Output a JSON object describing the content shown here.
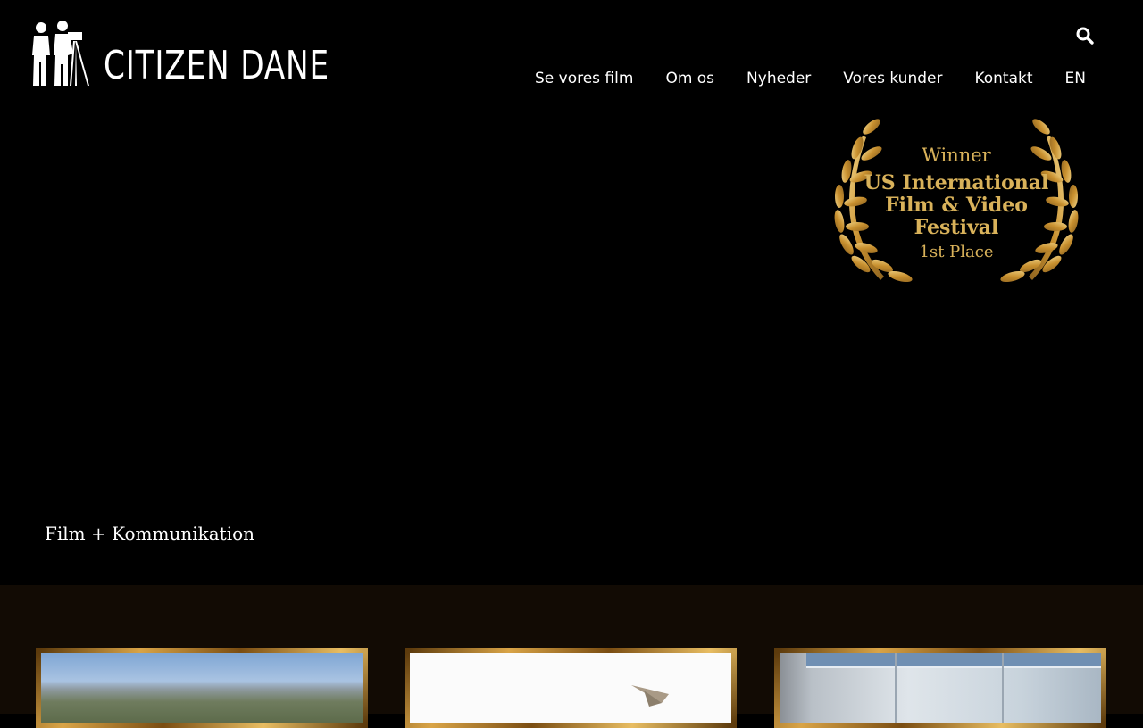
{
  "brand": {
    "name": "CITIZEN DANE"
  },
  "nav": {
    "items": [
      {
        "label": "Se vores film"
      },
      {
        "label": "Om os"
      },
      {
        "label": "Nyheder"
      },
      {
        "label": "Vores kunder"
      },
      {
        "label": "Kontakt"
      },
      {
        "label": "EN"
      }
    ]
  },
  "award": {
    "line1": "Winner",
    "line2": "US International",
    "line3": "Film & Video",
    "line4": "Festival",
    "line5": "1st Place",
    "color": "#d9b25a"
  },
  "hero": {
    "tagline": "Film + Kommunikation"
  },
  "icons": {
    "search": "search-icon",
    "laurel": "laurel-wreath-icon"
  },
  "colors": {
    "background": "#000000",
    "cards_background": "#120b04",
    "frame_gold": "#c8902f"
  }
}
